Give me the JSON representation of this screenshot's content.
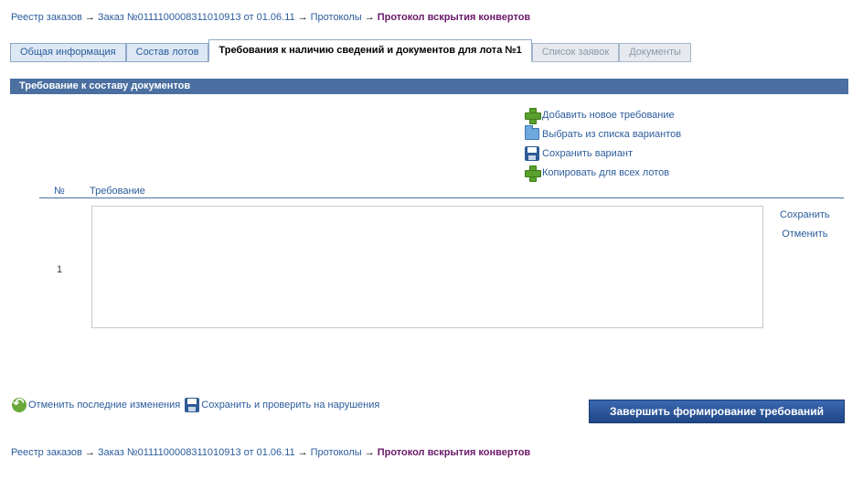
{
  "breadcrumb": {
    "items": [
      "Реестр заказов",
      "Заказ №0111100008311010913 от 01.06.11",
      "Протоколы"
    ],
    "current": "Протокол вскрытия конвертов",
    "separator": "→"
  },
  "tabs": [
    {
      "label": "Общая информация",
      "state": "normal"
    },
    {
      "label": "Состав лотов",
      "state": "normal"
    },
    {
      "label": "Требования к наличию сведений и документов для лота №1",
      "state": "active"
    },
    {
      "label": "Список заявок",
      "state": "disabled"
    },
    {
      "label": "Документы",
      "state": "disabled"
    }
  ],
  "section": {
    "title": "Требование к составу документов"
  },
  "actions": {
    "add_new": {
      "label": "Добавить новое требование",
      "icon": "plus-icon"
    },
    "choose_from_list": {
      "label": "Выбрать из списка вариантов",
      "icon": "folder-icon"
    },
    "save_variant": {
      "label": "Сохранить вариант",
      "icon": "floppy-icon"
    },
    "copy_all_lots": {
      "label": "Копировать для всех лотов",
      "icon": "plus-icon"
    }
  },
  "table": {
    "headers": {
      "num": "№",
      "requirement": "Требование"
    },
    "rows": [
      {
        "num": "1",
        "requirement": "",
        "save_label": "Сохранить",
        "cancel_label": "Отменить"
      }
    ]
  },
  "bottom": {
    "undo_label": "Отменить последние изменения",
    "save_check_label": "Сохранить и проверить на нарушения",
    "finish_label": "Завершить формирование требований"
  },
  "colors": {
    "link": "#2b5c9c",
    "current_crumb": "#6a1a6a",
    "section_bar": "#4a6fa0",
    "button": "#1f4687"
  }
}
